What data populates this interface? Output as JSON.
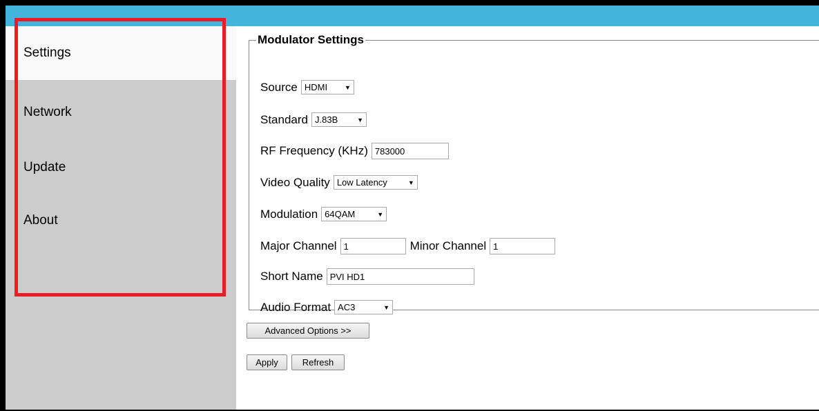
{
  "sidebar": {
    "items": [
      {
        "label": "Settings"
      },
      {
        "label": "Network"
      },
      {
        "label": "Update"
      },
      {
        "label": "About"
      }
    ]
  },
  "modulator": {
    "title": "Modulator Settings",
    "source": {
      "label": "Source",
      "value": "HDMI"
    },
    "standard": {
      "label": "Standard",
      "value": "J.83B"
    },
    "rf_frequency": {
      "label": "RF Frequency (KHz)",
      "value": "783000"
    },
    "video_quality": {
      "label": "Video Quality",
      "value": "Low Latency"
    },
    "modulation": {
      "label": "Modulation",
      "value": "64QAM"
    },
    "major_channel": {
      "label": "Major Channel",
      "value": "1"
    },
    "minor_channel": {
      "label": "Minor Channel",
      "value": "1"
    },
    "short_name": {
      "label": "Short Name",
      "value": "PVI HD1"
    },
    "audio_format": {
      "label": "Audio Format",
      "value": "AC3"
    }
  },
  "buttons": {
    "advanced": "Advanced Options >>",
    "apply": "Apply",
    "refresh": "Refresh"
  },
  "icons": {
    "dropdown_caret": "▼"
  },
  "colors": {
    "topbar": "#44b6dd",
    "sidebar": "#cccccc",
    "highlight": "#ed1c24"
  }
}
